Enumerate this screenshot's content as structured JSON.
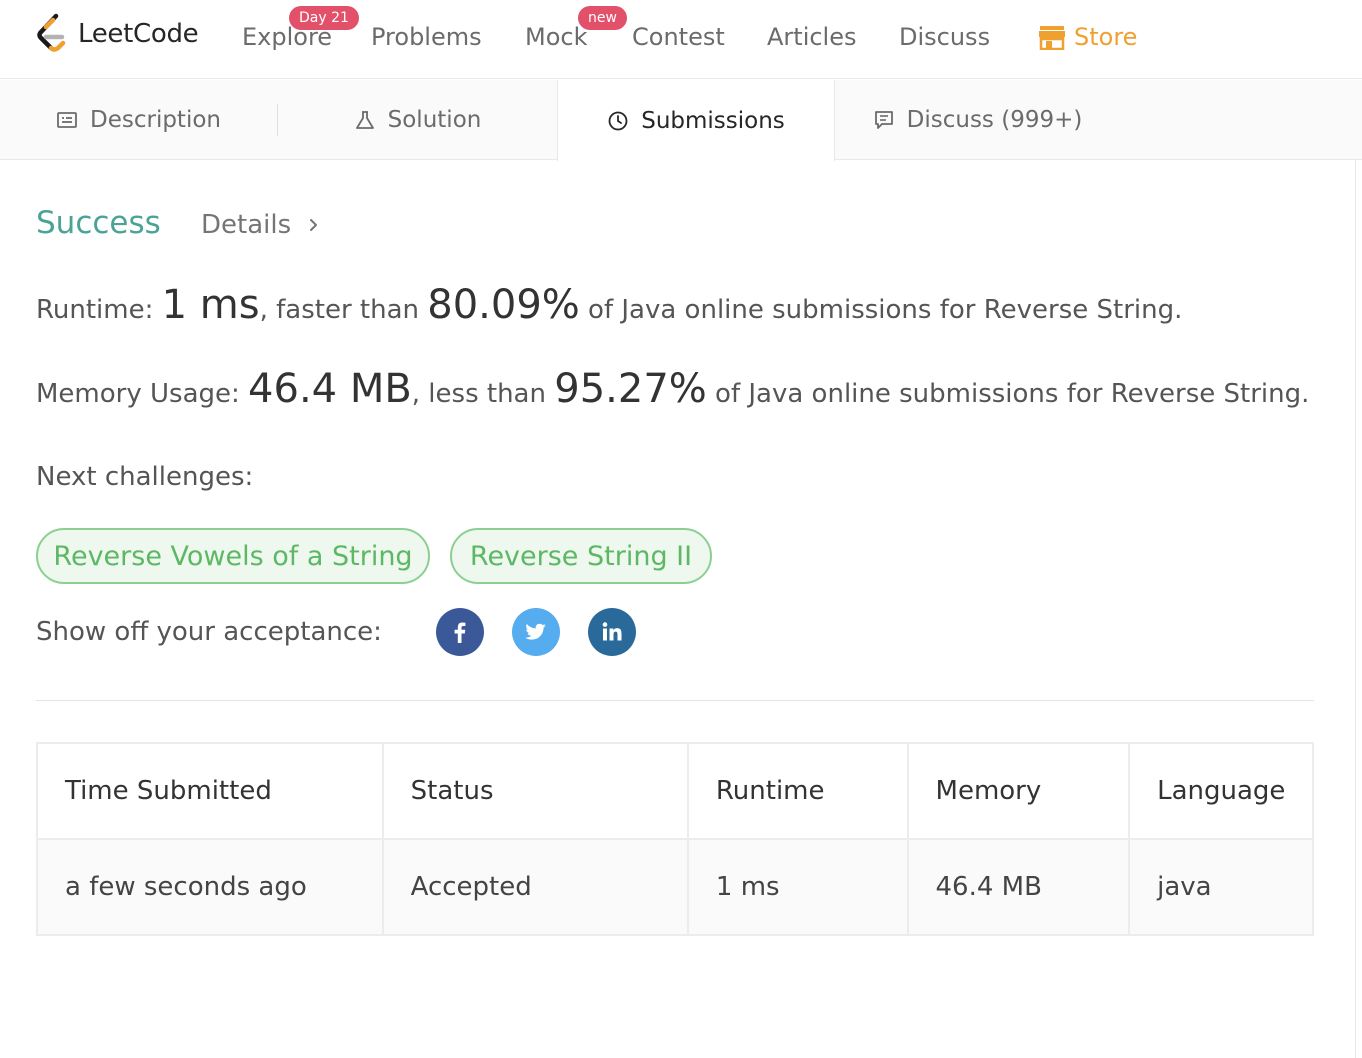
{
  "brand": {
    "name": "LeetCode"
  },
  "nav": {
    "explore": "Explore",
    "explore_badge": "Day 21",
    "problems": "Problems",
    "mock": "Mock",
    "mock_badge": "new",
    "contest": "Contest",
    "articles": "Articles",
    "discuss": "Discuss",
    "store": "Store"
  },
  "tabs": {
    "description": "Description",
    "solution": "Solution",
    "submissions": "Submissions",
    "discuss": "Discuss (999+)"
  },
  "result": {
    "status": "Success",
    "details": "Details",
    "runtime_label": "Runtime: ",
    "runtime_value": "1 ms",
    "runtime_mid": ", faster than ",
    "runtime_pct": "80.09%",
    "runtime_tail": " of Java online submissions for Reverse String.",
    "memory_label": "Memory Usage: ",
    "memory_value": "46.4 MB",
    "memory_mid": ", less than ",
    "memory_pct": "95.27%",
    "memory_tail": " of Java online submissions for Reverse String."
  },
  "next": {
    "label": "Next challenges:",
    "challenges": [
      "Reverse Vowels of a String",
      "Reverse String II"
    ]
  },
  "share": {
    "label": "Show off your acceptance:",
    "icons": [
      "facebook-icon",
      "twitter-icon",
      "linkedin-icon"
    ],
    "colors": {
      "facebook": "#3b5998",
      "twitter": "#55acee",
      "linkedin": "#2a6a9b"
    }
  },
  "table": {
    "headers": [
      "Time Submitted",
      "Status",
      "Runtime",
      "Memory",
      "Language"
    ],
    "rows": [
      [
        "a few seconds ago",
        "Accepted",
        "1 ms",
        "46.4 MB",
        "java"
      ]
    ]
  },
  "colors": {
    "success": "#4aa396",
    "store": "#f0a030",
    "badge": "#e2506a",
    "pill_border": "#8ccf92",
    "pill_text": "#5cb864"
  }
}
